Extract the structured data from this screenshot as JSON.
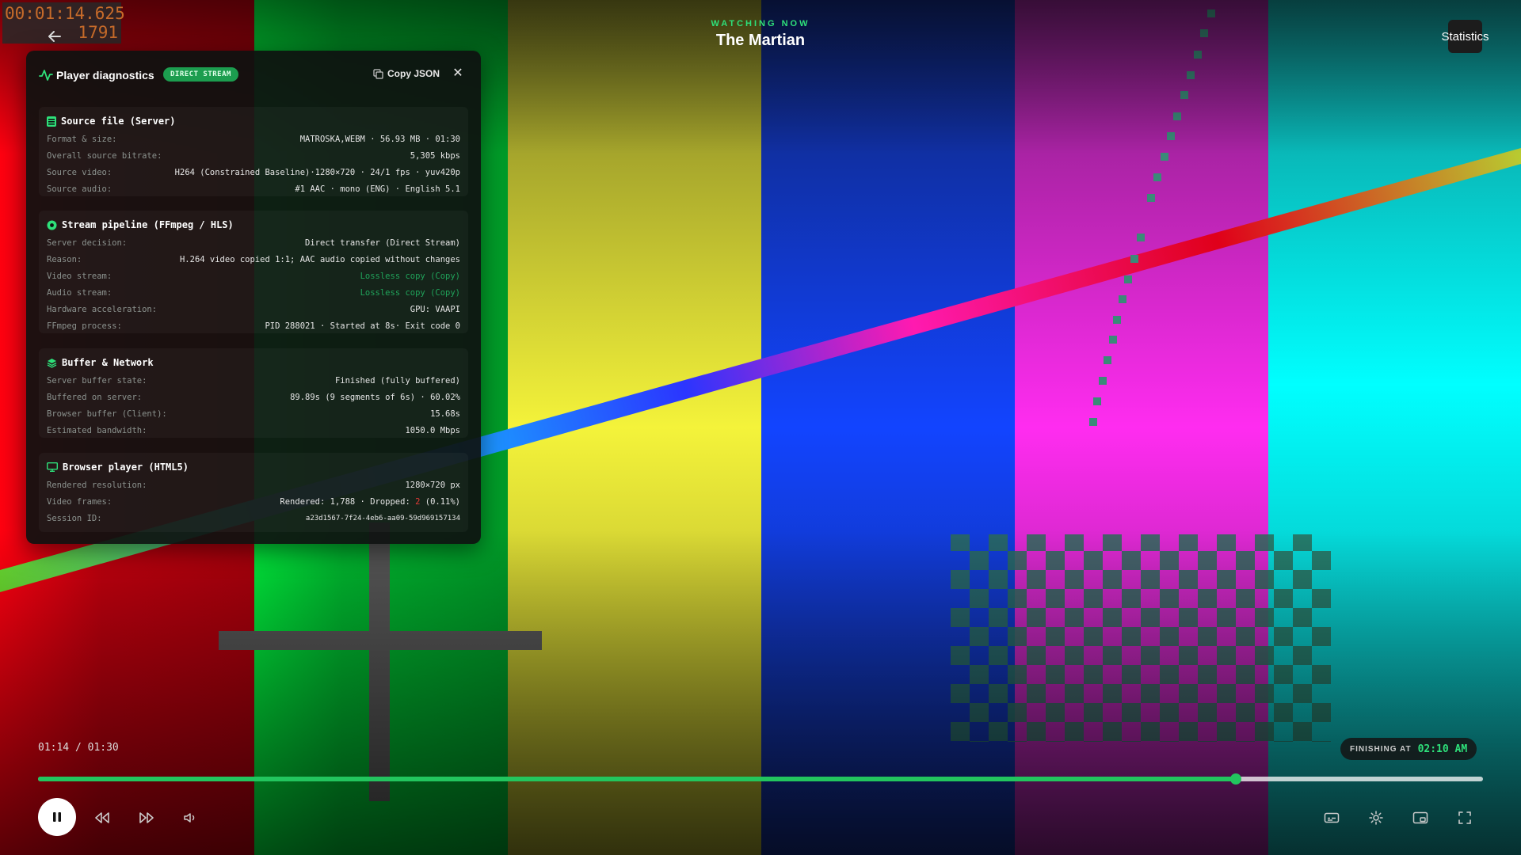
{
  "overlay": {
    "timecode": "00:01:14.625",
    "frame": "1791"
  },
  "header": {
    "eyebrow": "WATCHING NOW",
    "title": "The Martian",
    "statistics_button": "Statistics"
  },
  "diagnostics": {
    "title": "Player diagnostics",
    "badge": "DIRECT STREAM",
    "copy_label": "Copy JSON",
    "close_label": "✕",
    "source": {
      "title": "Source file (Server)",
      "rows": [
        {
          "key": "Format & size:",
          "value": "MATROSKA,WEBM · 56.93 MB · 01:30"
        },
        {
          "key": "Overall source bitrate:",
          "value": "5,305 kbps"
        },
        {
          "key": "Source video:",
          "value": "H264 (Constrained Baseline)·1280×720 · 24/1 fps · yuv420p"
        },
        {
          "key": "Source audio:",
          "value": "#1 AAC · mono (ENG) · English 5.1"
        }
      ]
    },
    "pipeline": {
      "title": "Stream pipeline (FFmpeg / HLS)",
      "rows": [
        {
          "key": "Server decision:",
          "value": "Direct transfer (Direct Stream)"
        },
        {
          "key": "Reason:",
          "value": "H.264 video copied 1:1; AAC audio copied without changes"
        },
        {
          "key": "Video stream:",
          "value": "Lossless copy (Copy)"
        },
        {
          "key": "Audio stream:",
          "value": "Lossless copy (Copy)"
        },
        {
          "key": "Hardware acceleration:",
          "value": "GPU: VAAPI"
        },
        {
          "key": "FFmpeg process:",
          "value": "PID 288021 · Started at 8s· Exit code 0"
        }
      ]
    },
    "buffer": {
      "title": "Buffer & Network",
      "rows": [
        {
          "key": "Server buffer state:",
          "value": "Finished (fully buffered)"
        },
        {
          "key": "Buffered on server:",
          "value": "89.89s (9 segments of 6s) · 60.02%"
        },
        {
          "key": "Browser buffer (Client):",
          "value": "15.68s"
        },
        {
          "key": "Estimated bandwidth:",
          "value": "1050.0 Mbps"
        }
      ]
    },
    "browser": {
      "title": "Browser player (HTML5)",
      "rendered_key": "Rendered resolution:",
      "rendered_value": "1280×720 px",
      "frames_key": "Video frames:",
      "frames_prefix": "Rendered: 1,788 · Dropped: ",
      "frames_dropped": "2",
      "frames_suffix": " (0.11%)",
      "session_key": "Session ID:",
      "session_value": "a23d1567-7f24-4eb6-aa09-59d969157134"
    }
  },
  "player": {
    "time_display": "01:14 / 01:30",
    "finishing_label": "FINISHING AT",
    "finishing_time": "02:10 AM",
    "progress_fraction": 0.829
  },
  "colors": {
    "accent": "#22c55e",
    "dropped": "#e53935"
  },
  "icons": [
    "back-arrow-icon",
    "activity-icon",
    "copy-icon",
    "close-icon",
    "database-icon",
    "gear-icon",
    "layers-icon",
    "monitor-icon",
    "pause-icon",
    "rewind-icon",
    "fast-forward-icon",
    "volume-icon",
    "subtitles-icon",
    "settings-icon",
    "picture-in-picture-icon",
    "fullscreen-icon"
  ]
}
